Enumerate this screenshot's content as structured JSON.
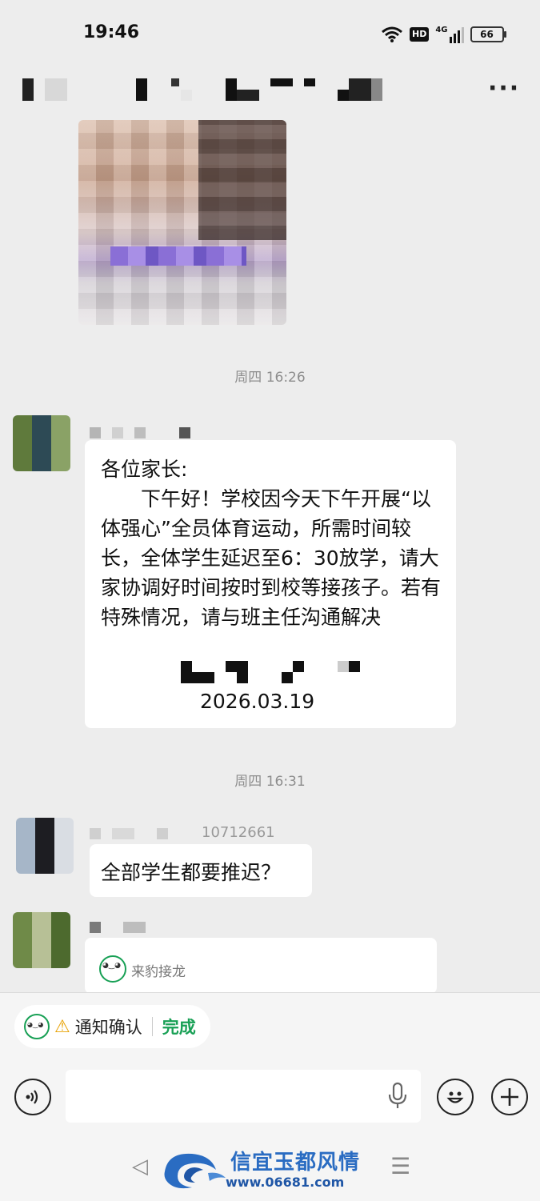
{
  "status_bar": {
    "time": "19:46",
    "network_badge": "HD",
    "network_type": "4G",
    "battery": "66"
  },
  "header": {
    "title": "",
    "more_icon": "more-dots-icon"
  },
  "messages": {
    "timestamp_1": "周四 16:26",
    "notice": {
      "greeting": "各位家长:",
      "body": "下午好！学校因今天下午开展“以体强心”全员体育运动，所需时间较长，全体学生延迟至6：30放学，请大家协调好时间按时到校等接孩子。若有特殊情况，请与班主任沟通解决",
      "date": "2026.03.19"
    },
    "timestamp_2": "周四 16:31",
    "reply": {
      "sender_suffix": "10712661",
      "text": "全部学生都要推迟？"
    },
    "card": {
      "app_name": "来豹接龙"
    }
  },
  "bottom": {
    "notice_chip": {
      "label": "通知确认",
      "status": "完成"
    }
  },
  "watermark": {
    "title": "信宜玉都风情",
    "url": "www.06681.com"
  },
  "colors": {
    "accent_green": "#18a055",
    "background": "#ededed",
    "watermark_blue": "#2a6cc2"
  }
}
